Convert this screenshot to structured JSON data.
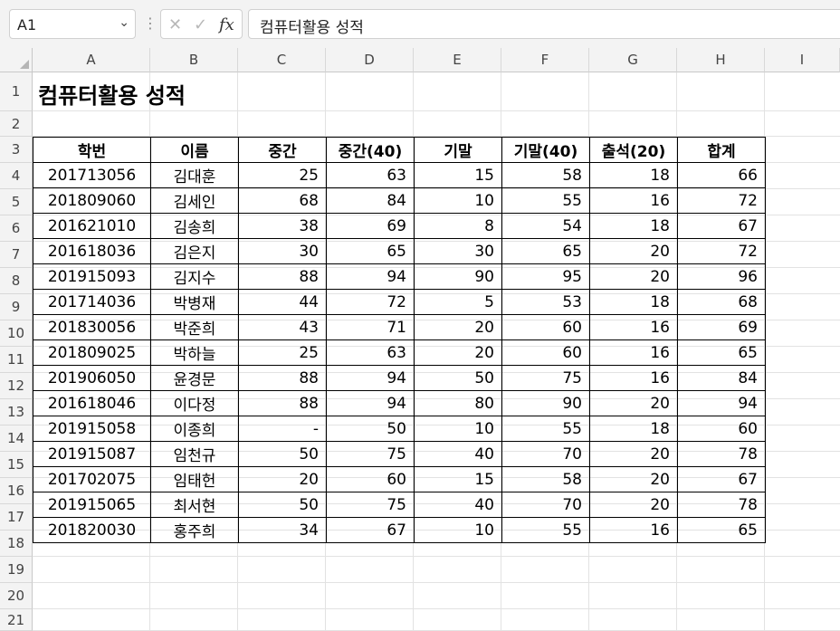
{
  "formula_bar": {
    "name_box": "A1",
    "name_box_caret": "⌄",
    "separator": "⋮",
    "cancel_glyph": "✕",
    "enter_glyph": "✓",
    "fx_label": "fx",
    "formula_value": "컴퓨터활용 성적"
  },
  "columns": [
    "A",
    "B",
    "C",
    "D",
    "E",
    "F",
    "G",
    "H",
    "I"
  ],
  "rows": [
    "1",
    "2",
    "3",
    "4",
    "5",
    "6",
    "7",
    "8",
    "9",
    "10",
    "11",
    "12",
    "13",
    "14",
    "15",
    "16",
    "17",
    "18",
    "19",
    "20",
    "21"
  ],
  "sheet": {
    "title": "컴퓨터활용 성적",
    "headers": [
      "학번",
      "이름",
      "중간",
      "중간(40)",
      "기말",
      "기말(40)",
      "출석(20)",
      "합계"
    ],
    "records": [
      [
        "201713056",
        "김대훈",
        "25",
        "63",
        "15",
        "58",
        "18",
        "66"
      ],
      [
        "201809060",
        "김세인",
        "68",
        "84",
        "10",
        "55",
        "16",
        "72"
      ],
      [
        "201621010",
        "김송희",
        "38",
        "69",
        "8",
        "54",
        "18",
        "67"
      ],
      [
        "201618036",
        "김은지",
        "30",
        "65",
        "30",
        "65",
        "20",
        "72"
      ],
      [
        "201915093",
        "김지수",
        "88",
        "94",
        "90",
        "95",
        "20",
        "96"
      ],
      [
        "201714036",
        "박병재",
        "44",
        "72",
        "5",
        "53",
        "18",
        "68"
      ],
      [
        "201830056",
        "박준희",
        "43",
        "71",
        "20",
        "60",
        "16",
        "69"
      ],
      [
        "201809025",
        "박하늘",
        "25",
        "63",
        "20",
        "60",
        "16",
        "65"
      ],
      [
        "201906050",
        "윤경문",
        "88",
        "94",
        "50",
        "75",
        "16",
        "84"
      ],
      [
        "201618046",
        "이다정",
        "88",
        "94",
        "80",
        "90",
        "20",
        "94"
      ],
      [
        "201915058",
        "이종희",
        "-",
        "50",
        "10",
        "55",
        "18",
        "60"
      ],
      [
        "201915087",
        "임천규",
        "50",
        "75",
        "40",
        "70",
        "20",
        "78"
      ],
      [
        "201702075",
        "임태헌",
        "20",
        "60",
        "15",
        "58",
        "20",
        "67"
      ],
      [
        "201915065",
        "최서현",
        "50",
        "75",
        "40",
        "70",
        "20",
        "78"
      ],
      [
        "201820030",
        "홍주희",
        "34",
        "67",
        "10",
        "55",
        "16",
        "65"
      ]
    ]
  }
}
